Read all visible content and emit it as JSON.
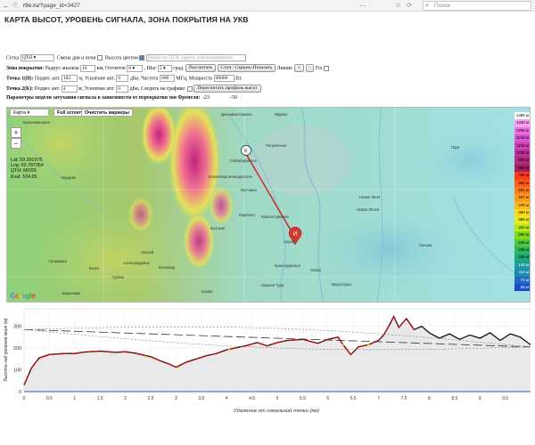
{
  "browser": {
    "url_host": "r9o.ru",
    "url_path": "/?page_id=3427",
    "search_placeholder": "Поиск"
  },
  "page_title": "КАРТА ВЫСОТ, УРОВЕНЬ СИГНАЛА, ЗОНА ПОКРЫТИЯ НА УКВ",
  "controls": {
    "grid_label": "Сетка",
    "grid_value": "QTH",
    "daynight_label": "Смена дня и ночи",
    "height_color_label": "Высота цветом",
    "search_placeholder": "Поиск по QTH, адресу, или координатам",
    "coverage_label": "Зона покрытия:",
    "radius_label": "Радиус анализа",
    "radius_value": "10",
    "radius_unit": "км, Отсчетов",
    "samples_value": "8",
    "step_label": ", Шаг",
    "step_value": "5",
    "step_unit": "град.",
    "calc_button": "Рассчитать",
    "stop_button": "Стоп / Скрыть-Показать",
    "lines_label": "Линии:",
    "plus": "+",
    "minus": "-",
    "fix_label": "Fix",
    "point1_label": "Точка 1(И):",
    "antenna_height_label": "Подвес ант.",
    "point1_height": "182",
    "meters": "м,",
    "gain_label": "Усиление ант.",
    "point1_gain": "0",
    "dbi": "дБи,",
    "freq_label": "Частота",
    "freq_value": "600",
    "mhz": "МГц,",
    "power_label": "Мощность",
    "power_value": "00000",
    "watts": "Вт.",
    "point2_label": "Точка 2(К):",
    "point2_height": "4",
    "point2_gain": "0",
    "follow_label": "дБи, Следить на графике:",
    "recalc_button": "Пересчитать профиль высот",
    "model_label": "Параметры модели затухания сигнала в зависимости от перекрытия зон Френеля:",
    "model_val1": "-23",
    "model_val2": "-50"
  },
  "map": {
    "type_value": "Карта",
    "fullscreen": "Full screen",
    "clear_markers": "Очистить маркеры",
    "zoom_in": "+",
    "zoom_out": "−",
    "lat": "Lat: 59.391975",
    "lng": "Lng: 60.787354",
    "qth": "QTH: MO09",
    "eval": "Eval: 164.65",
    "google": "Google",
    "marker_k": "K",
    "marker_i": "И",
    "labels": [
      "Красновишерск",
      "Североуральск",
      "Карпинск",
      "Краснотурьинск",
      "Серов",
      "Новая Ляля",
      "Волчанск",
      "Лобва",
      "Сосьва",
      "Ивдель",
      "Красноуральск",
      "Полуночное",
      "Кытлым",
      "Чердынь",
      "Гари",
      "Верхотурье",
      "Лесной",
      "Качканар",
      "Кушва",
      "Нижняя Тура",
      "Денежкин Камень",
      "Всеволодо-Благодатское",
      "Александровск",
      "Кизел",
      "Губаха",
      "Соликамск",
      "Березники",
      "Новая Лялья"
    ],
    "legend": [
      "1485 м",
      "1400 м",
      "1308 м",
      "1218 м",
      "1125 м",
      "1035 м",
      "945 м",
      "855 м",
      "765 м",
      "690 м",
      "601 м",
      "567 м",
      "478 м",
      "390 м",
      "365 м",
      "334 м",
      "290 м",
      "245 м",
      "205 м",
      "155 м",
      "149 м",
      "110 м",
      "71 м",
      "55 м"
    ],
    "legend_colors": [
      "#ffffff",
      "#ff9ff3",
      "#f06de6",
      "#e052d6",
      "#d13fb9",
      "#c0329a",
      "#b3297e",
      "#a31f64",
      "#ff3a1a",
      "#ff5a1a",
      "#ff7a1a",
      "#ff9a1a",
      "#ffb81a",
      "#ffd81a",
      "#e8e81a",
      "#b8e81a",
      "#7fd81a",
      "#4fc83a",
      "#2fb85a",
      "#1fa87a",
      "#1f9a9a",
      "#1f8ab0",
      "#1f6ac0",
      "#1f4ad0"
    ]
  },
  "profile": {
    "y_label": "Высота над уровнем моря (м)",
    "x_label": "Удаление от начальной точки (км)",
    "y_ticks": [
      "300",
      "200",
      "100",
      "0"
    ],
    "x_ticks": [
      "0",
      "0.5",
      "1",
      "1.5",
      "2",
      "2.5",
      "3",
      "3.5",
      "4",
      "4.5",
      "5",
      "5.5",
      "6",
      "6.5",
      "7",
      "7.5",
      "8",
      "8.5",
      "9",
      "9.5"
    ]
  }
}
